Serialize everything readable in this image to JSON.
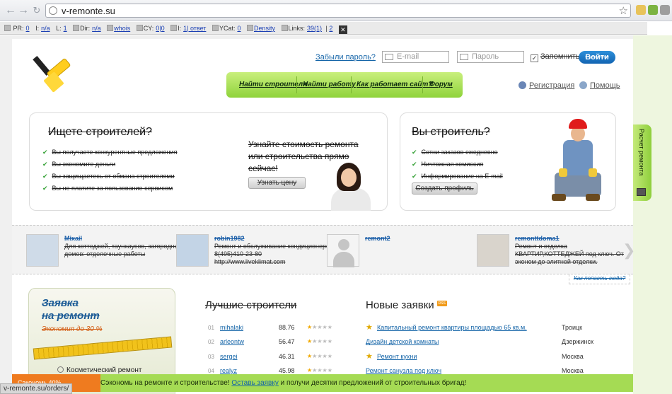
{
  "browser": {
    "url": "v-remonte.su",
    "status_url": "v-remonte.su/orders/"
  },
  "seo_bar": {
    "pr_label": "PR:",
    "pr_value": "0",
    "i_label": "I:",
    "i_value": "n/a",
    "l_label": "L:",
    "l_value": "1",
    "dir_label": "Dir:",
    "dir_value": "n/a",
    "whois": "whois",
    "cy_label": "CY:",
    "cy_value": "0|0",
    "i2_label": "I:",
    "i2_value": "1| ответ",
    "ycat_label": "YCat:",
    "ycat_value": "0",
    "density": "Density",
    "links_label": "Links:",
    "links_value": "39(1)",
    "links_extra": "2"
  },
  "header": {
    "forgot_password": "Забыли пароль?",
    "email_placeholder": "E-mail",
    "password_placeholder": "Пароль",
    "remember": "Запомнить",
    "login": "Войти",
    "register": "Регистрация",
    "help": "Помощь"
  },
  "menu": {
    "items": [
      "Найти строителя",
      "Найти работу",
      "Как работает сайт?",
      "Форум"
    ]
  },
  "customer_card": {
    "title": "Ищете строителей?",
    "bullets": [
      "Вы получаете конкурентные предложения",
      "Вы экономите деньги",
      "Вы защищаетесь от обмана строителями",
      "Вы не платите за пользование сервисом"
    ],
    "cta_text": "Узнайте стоимость ремонта или строительства прямо сейчас!",
    "cta_button": "Узнать цену"
  },
  "builder_card": {
    "title": "Вы строитель?",
    "bullets": [
      "Сотни заказов ежедневно",
      "Ничтожная комиссия",
      "Информирование на E-mail"
    ],
    "button": "Создать профиль"
  },
  "pros": [
    {
      "name": "Mixail",
      "desc": "Для коттеджей, таунхаусов, загородных домов: отделочные работы"
    },
    {
      "name": "robin1982",
      "desc": "Ремонт и обслуживание кондиционеров 8(495)410-23-80 http://www.liveklimat.com"
    },
    {
      "name": "remont2",
      "desc": ""
    },
    {
      "name": "remonttdoma1",
      "desc": "Ремонт и отделка КВАРТИР,КОТТЕДЖЕЙ под ключ. От эконом до элитной отделки."
    }
  ],
  "how_link": "Как попасть сюда?",
  "request_block": {
    "title_line1": "Заявка",
    "title_line2": "на ремонт",
    "subtitle": "Экономия до 30 %",
    "option": "Косметический ремонт"
  },
  "best": {
    "title": "Лучшие строители",
    "rows": [
      {
        "num": "01",
        "name": "mihalaki",
        "score": "88.76",
        "rating": 1
      },
      {
        "num": "02",
        "name": "arleontw",
        "score": "56.47",
        "rating": 1
      },
      {
        "num": "03",
        "name": "sergei",
        "score": "46.31",
        "rating": 1
      },
      {
        "num": "04",
        "name": "realyz",
        "score": "45.98",
        "rating": 1
      }
    ]
  },
  "new_requests": {
    "title": "Новые заявки",
    "rss": "RSS",
    "rows": [
      {
        "title": "Капитальный ремонт квартиры площадью 65 кв.м.",
        "city": "Троицк",
        "star": true
      },
      {
        "title": "Дизайн детской комнаты",
        "city": "Дзержинск",
        "star": false
      },
      {
        "title": "Ремонт кухни",
        "city": "Москва",
        "star": true
      },
      {
        "title": "Ремонт санузла под ключ",
        "city": "Москва",
        "star": false
      }
    ]
  },
  "side_tab": {
    "label": "Расчет ремонта"
  },
  "banner": {
    "lead": "Сэкономь на ремонте и строительстве!",
    "link": "Оставь заявку",
    "rest": "и получи десятки предложений от строительных бригад!"
  },
  "save_tab": "Сэкономь 40%",
  "colors": {
    "green": "#a5db54",
    "blue_link": "#1565a8",
    "orange": "#ef7b1f"
  }
}
